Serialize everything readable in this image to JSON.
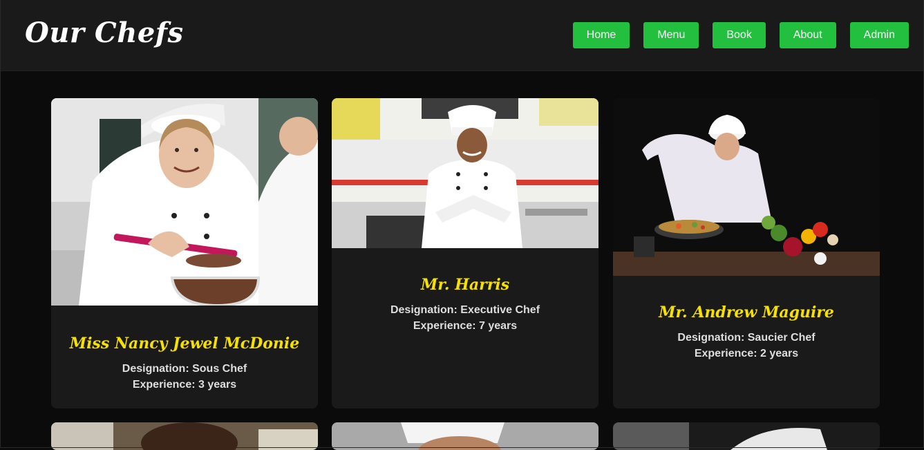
{
  "header": {
    "title": "Our Chefs",
    "nav": [
      "Home",
      "Menu",
      "Book",
      "About",
      "Admin"
    ]
  },
  "colors": {
    "accent": "#22c03e",
    "name": "#f5e000",
    "card": "#1a1a1a",
    "background": "#0b0b0b"
  },
  "chefs": [
    {
      "name": "Miss Nancy Jewel McDonie",
      "designation": "Designation: Sous Chef",
      "experience": "Experience: 3 years"
    },
    {
      "name": "Mr. Harris",
      "designation": "Designation: Executive Chef",
      "experience": "Experience: 7 years"
    },
    {
      "name": "Mr. Andrew Maguire",
      "designation": "Designation: Saucier Chef",
      "experience": "Experience: 2 years"
    }
  ]
}
